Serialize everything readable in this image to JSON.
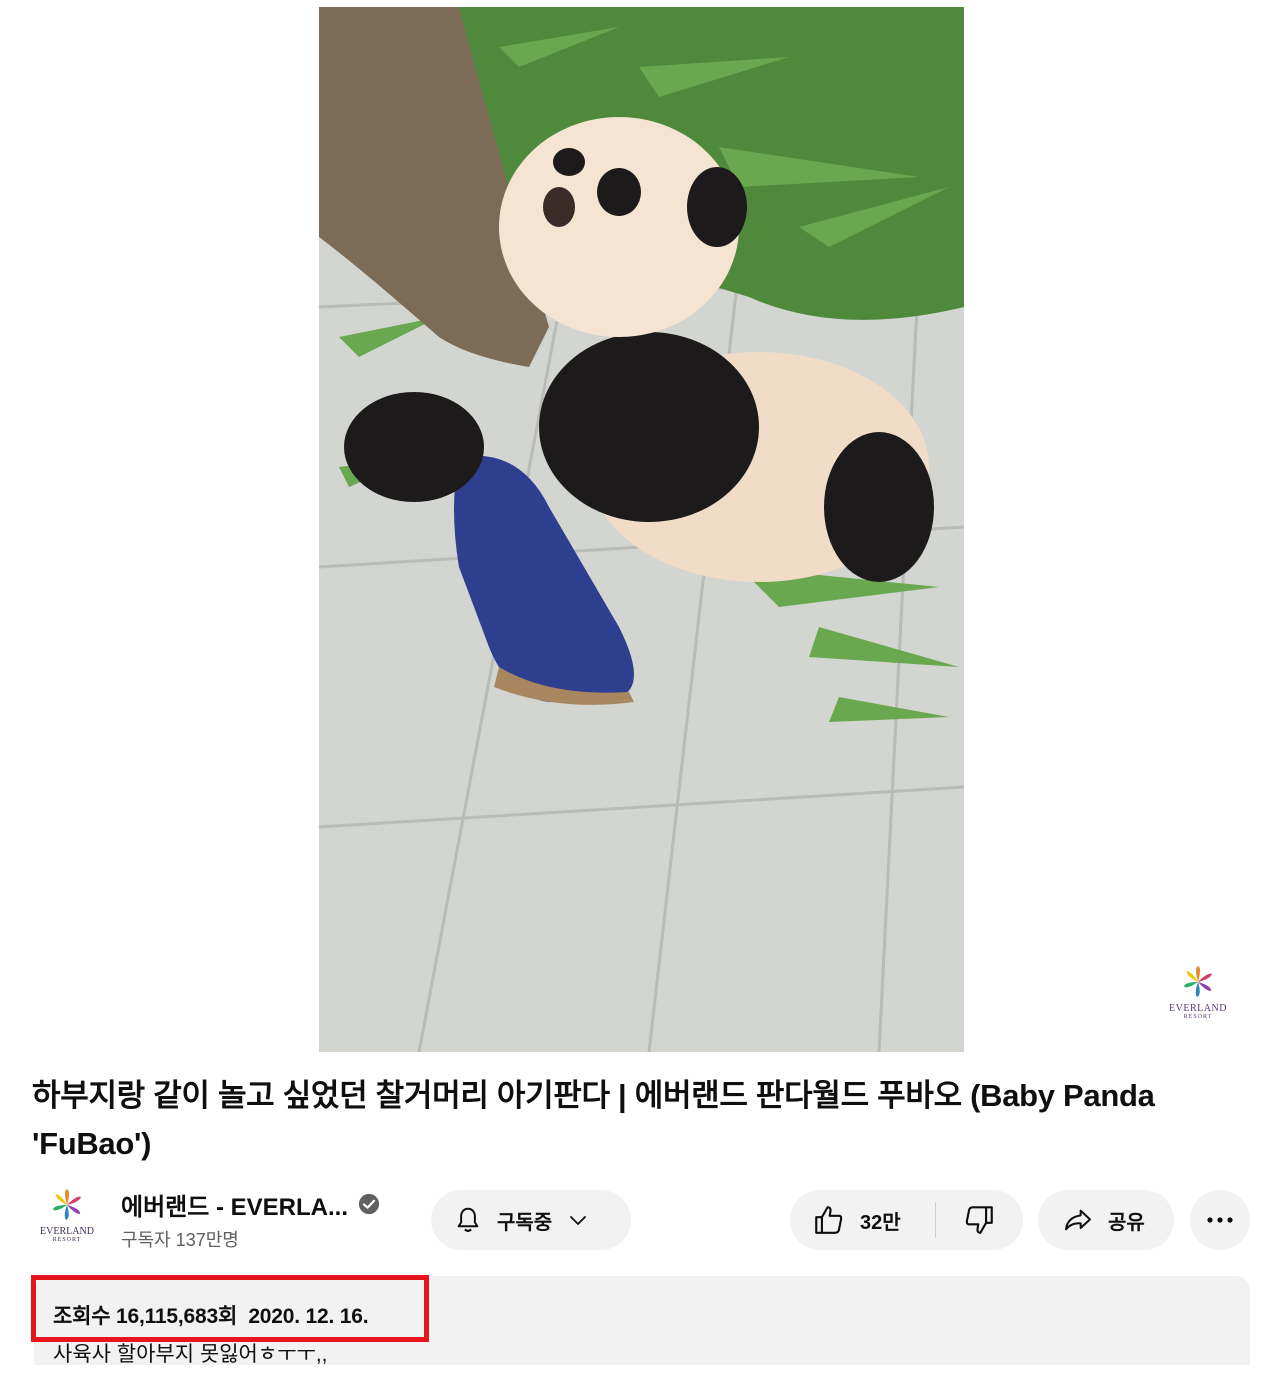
{
  "video": {
    "description": "video frame",
    "watermark_text": "EVERLAND",
    "watermark_sub": "RESORT"
  },
  "title": "하부지랑 같이 놀고 싶었던 찰거머리 아기판다 | 에버랜드 판다월드 푸바오 (Baby Panda 'FuBao')",
  "channel": {
    "avatar_text": "EVERLAND",
    "avatar_sub": "RESORT",
    "name": "에버랜드 - EVERLA...",
    "subscribers": "구독자 137만명",
    "verified_icon": "verified-check-icon"
  },
  "actions": {
    "subscribe_label": "구독중",
    "like_count": "32만",
    "share_label": "공유"
  },
  "description": {
    "views_and_date": "조회수 16,115,683회  2020. 12. 16.",
    "first_line": "사육사 할아부지 못잃어ㅎㅜㅜ,,"
  },
  "colors": {
    "highlight": "#e8141c",
    "pill_bg": "#f2f2f2"
  }
}
